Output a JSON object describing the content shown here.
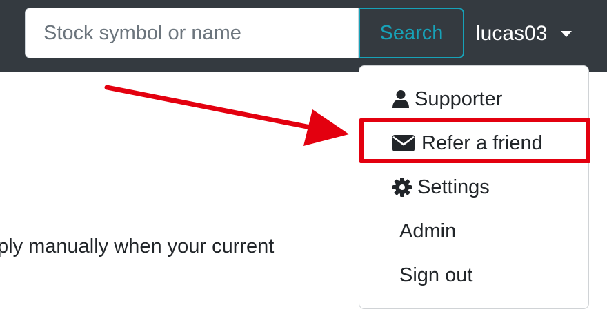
{
  "navbar": {
    "search": {
      "placeholder": "Stock symbol or name",
      "value": "",
      "button_label": "Search"
    },
    "user": {
      "name": "lucas03"
    }
  },
  "dropdown": {
    "items": [
      {
        "label": "Supporter",
        "icon": "user-icon"
      },
      {
        "label": "Refer a friend",
        "icon": "envelope-icon"
      },
      {
        "label": "Settings",
        "icon": "gear-icon"
      },
      {
        "label": "Admin",
        "icon": ""
      },
      {
        "label": "Sign out",
        "icon": ""
      }
    ]
  },
  "page": {
    "partial_text": "ply manually when your current"
  },
  "annotation": {
    "highlight_color": "#e3000f",
    "arrow_color": "#e3000f",
    "highlighted_item": "Refer a friend"
  },
  "colors": {
    "navbar": "#343a40",
    "accent": "#17a2b8"
  }
}
